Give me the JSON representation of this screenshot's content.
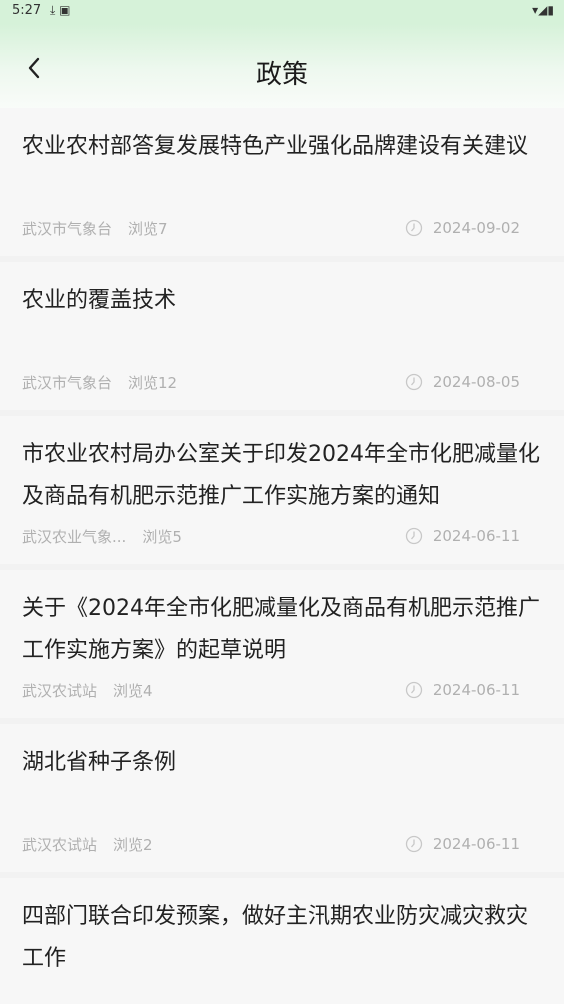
{
  "status": {
    "time": "5:27",
    "left_icons": "⤓ ▣",
    "right_icons": "▾◢▮"
  },
  "header": {
    "title": "政策"
  },
  "items": [
    {
      "title": "农业农村部答复发展特色产业强化品牌建设有关建议",
      "source": "武汉市气象台",
      "views": "浏览7",
      "date": "2024-09-02"
    },
    {
      "title": "农业的覆盖技术",
      "source": "武汉市气象台",
      "views": "浏览12",
      "date": "2024-08-05"
    },
    {
      "title": "市农业农村局办公室关于印发2024年全市化肥减量化及商品有机肥示范推广工作实施方案的通知",
      "source": "武汉农业气象...",
      "views": "浏览5",
      "date": "2024-06-11"
    },
    {
      "title": "关于《2024年全市化肥减量化及商品有机肥示范推广工作实施方案》的起草说明",
      "source": "武汉农试站",
      "views": "浏览4",
      "date": "2024-06-11"
    },
    {
      "title": "湖北省种子条例",
      "source": "武汉农试站",
      "views": "浏览2",
      "date": "2024-06-11"
    },
    {
      "title": "四部门联合印发预案，做好主汛期农业防灾减灾救灾工作",
      "source": "",
      "views": "",
      "date": ""
    }
  ]
}
